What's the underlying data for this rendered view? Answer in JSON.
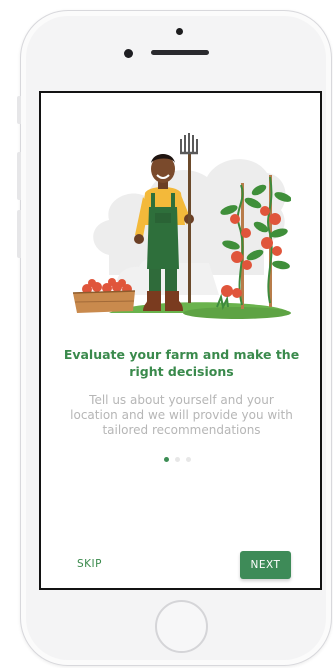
{
  "onboarding": {
    "title": "Evaluate your farm and make the right decisions",
    "description": "Tell us about yourself and your location and we will provide you with tailored recommendations",
    "pagination": {
      "total": 3,
      "current": 1
    },
    "illustration_icon": "farmer-with-pitchfork-illustration"
  },
  "actions": {
    "skip_label": "SKIP",
    "next_label": "NEXT"
  },
  "colors": {
    "accent": "#3a8a4c",
    "next_button": "#3e8b58",
    "description_text": "#b6b6b6",
    "dot_inactive": "#e7e7e7",
    "tomato": "#e0553b"
  }
}
